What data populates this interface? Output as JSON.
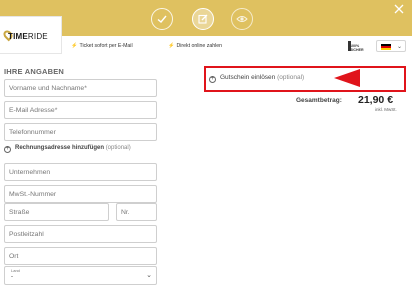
{
  "brand": {
    "name_bold": "TIME",
    "name_thin": "RIDE"
  },
  "colors": {
    "header": "#dfc160",
    "highlight": "#e0141b"
  },
  "steps": [
    {
      "name": "check-icon",
      "state": "done"
    },
    {
      "name": "edit-icon",
      "state": "active"
    },
    {
      "name": "eye-icon",
      "state": "upcoming"
    }
  ],
  "info": {
    "ticket_email": "Ticket sofort per E-Mail",
    "pay_online": "Direkt online zahlen"
  },
  "badge": {
    "line1": "100%",
    "line2": "SICHER"
  },
  "language": {
    "flag": "de-flag-icon"
  },
  "form": {
    "title": "IHRE ANGABEN",
    "name_placeholder": "Vorname und Nachname*",
    "email_placeholder": "E-Mail Adresse*",
    "phone_placeholder": "Telefonnummer",
    "billing_toggle": "Rechnungsadresse hinzufügen",
    "billing_optional": "(optional)",
    "company_placeholder": "Unternehmen",
    "vat_placeholder": "MwSt.-Nummer",
    "street_placeholder": "Straße",
    "nr_placeholder": "Nr.",
    "zip_placeholder": "Postleitzahl",
    "city_placeholder": "Ort",
    "country_label": "Land",
    "country_value": "-"
  },
  "voucher": {
    "label": "Gutschein einlösen",
    "optional": "(optional)"
  },
  "total": {
    "label": "Gesamtbetrag:",
    "value": "21,90 €",
    "note": "inkl. MwSt."
  }
}
